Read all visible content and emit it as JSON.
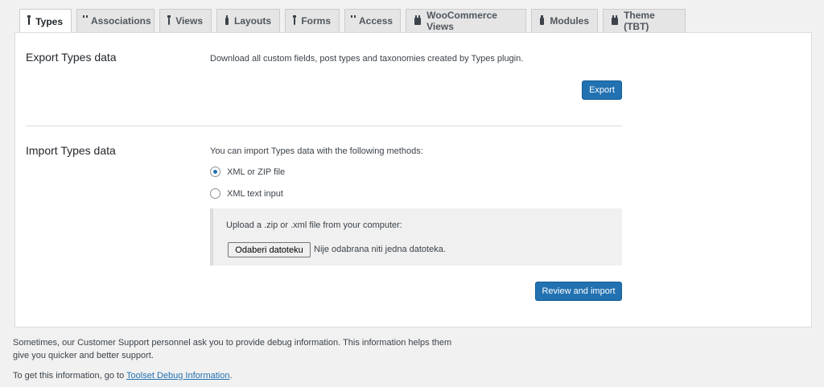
{
  "tabs": [
    {
      "label": "Types",
      "active": true
    },
    {
      "label": "Associations"
    },
    {
      "label": "Views"
    },
    {
      "label": "Layouts"
    },
    {
      "label": "Forms"
    },
    {
      "label": "Access"
    },
    {
      "label": "WooCommerce Views"
    },
    {
      "label": "Modules"
    },
    {
      "label": "Theme (TBT)"
    }
  ],
  "export": {
    "title": "Export Types data",
    "description": "Download all custom fields, post types and taxonomies created by Types plugin.",
    "button": "Export"
  },
  "import": {
    "title": "Import Types data",
    "description": "You can import Types data with the following methods:",
    "options": [
      {
        "label": "XML or ZIP file",
        "checked": true
      },
      {
        "label": "XML text input",
        "checked": false
      }
    ],
    "upload_label": "Upload a .zip or .xml file from your computer:",
    "file_button": "Odaberi datoteku",
    "file_status": "Nije odabrana niti jedna datoteka.",
    "submit_button": "Review and import"
  },
  "footer": {
    "line1": "Sometimes, our Customer Support personnel ask you to provide debug information. This information helps them",
    "line2": "give you quicker and better support.",
    "line3_prefix": "To get this information, go to ",
    "link_text": "Toolset Debug Information",
    "line3_suffix": "."
  },
  "colors": {
    "accent": "#2271b1",
    "background": "#f1f1f1"
  }
}
